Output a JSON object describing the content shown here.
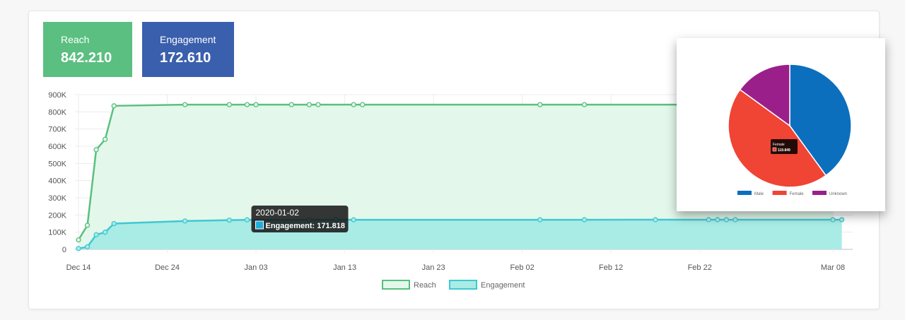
{
  "stats": {
    "reach": {
      "label": "Reach",
      "value": "842.210",
      "color": "#5abf80"
    },
    "engagement": {
      "label": "Engagement",
      "value": "172.610",
      "color": "#3a5fad"
    }
  },
  "chart_data": [
    {
      "type": "line",
      "xlabel": "",
      "ylabel": "",
      "y_ticks": [
        "0",
        "100K",
        "200K",
        "300K",
        "400K",
        "500K",
        "600K",
        "700K",
        "800K",
        "900K"
      ],
      "ylim": [
        0,
        900000
      ],
      "x_ticks": [
        "Dec 14",
        "Dec 24",
        "Jan 03",
        "Jan 13",
        "Jan 23",
        "Feb 02",
        "Feb 12",
        "Feb 22",
        "Mar 08"
      ],
      "x_tick_dates": [
        "2019-12-14",
        "2019-12-24",
        "2020-01-03",
        "2020-01-13",
        "2020-01-23",
        "2020-02-02",
        "2020-02-12",
        "2020-02-22",
        "2020-03-08"
      ],
      "grid": true,
      "legend_position": "bottom",
      "series": [
        {
          "name": "Reach",
          "color": "#5abf80",
          "fill": "#e3f8ea",
          "points": [
            [
              "2019-12-14",
              55000
            ],
            [
              "2019-12-15",
              140000
            ],
            [
              "2019-12-16",
              580000
            ],
            [
              "2019-12-17",
              640000
            ],
            [
              "2019-12-18",
              835000
            ],
            [
              "2019-12-26",
              842000
            ],
            [
              "2019-12-31",
              842000
            ],
            [
              "2020-01-02",
              842000
            ],
            [
              "2020-01-03",
              842000
            ],
            [
              "2020-01-07",
              842000
            ],
            [
              "2020-01-09",
              842000
            ],
            [
              "2020-01-10",
              842000
            ],
            [
              "2020-01-14",
              842000
            ],
            [
              "2020-01-15",
              842000
            ],
            [
              "2020-02-04",
              842000
            ],
            [
              "2020-02-09",
              842000
            ],
            [
              "2020-03-08",
              842210
            ]
          ]
        },
        {
          "name": "Engagement",
          "color": "#3fc8d4",
          "fill": "#a9ebe5",
          "points": [
            [
              "2019-12-14",
              5000
            ],
            [
              "2019-12-15",
              15000
            ],
            [
              "2019-12-16",
              85000
            ],
            [
              "2019-12-17",
              100000
            ],
            [
              "2019-12-18",
              150000
            ],
            [
              "2019-12-26",
              165000
            ],
            [
              "2019-12-31",
              170000
            ],
            [
              "2020-01-02",
              171818
            ],
            [
              "2020-01-09",
              172000
            ],
            [
              "2020-01-12",
              172000
            ],
            [
              "2020-01-14",
              172000
            ],
            [
              "2020-02-04",
              172200
            ],
            [
              "2020-02-09",
              172300
            ],
            [
              "2020-02-17",
              172400
            ],
            [
              "2020-02-23",
              172450
            ],
            [
              "2020-02-24",
              172500
            ],
            [
              "2020-02-25",
              172550
            ],
            [
              "2020-02-26",
              172580
            ],
            [
              "2020-03-08",
              172600
            ],
            [
              "2020-03-09",
              172610
            ]
          ]
        }
      ],
      "tooltip": {
        "title": "2020-01-02",
        "series": "Engagement",
        "label": "Engagement: 171.818",
        "swatch_color": "#1eaedb"
      }
    },
    {
      "type": "pie",
      "series": [
        {
          "name": "Male",
          "value": 40,
          "color": "#0b6fbe"
        },
        {
          "name": "Female",
          "value": 45,
          "color": "#f04434"
        },
        {
          "name": "Unknown",
          "value": 15,
          "color": "#9b1f8b"
        }
      ],
      "legend_position": "bottom",
      "tooltip": {
        "title": "Female",
        "label": "119.849",
        "swatch_color": "#f04434"
      }
    }
  ]
}
